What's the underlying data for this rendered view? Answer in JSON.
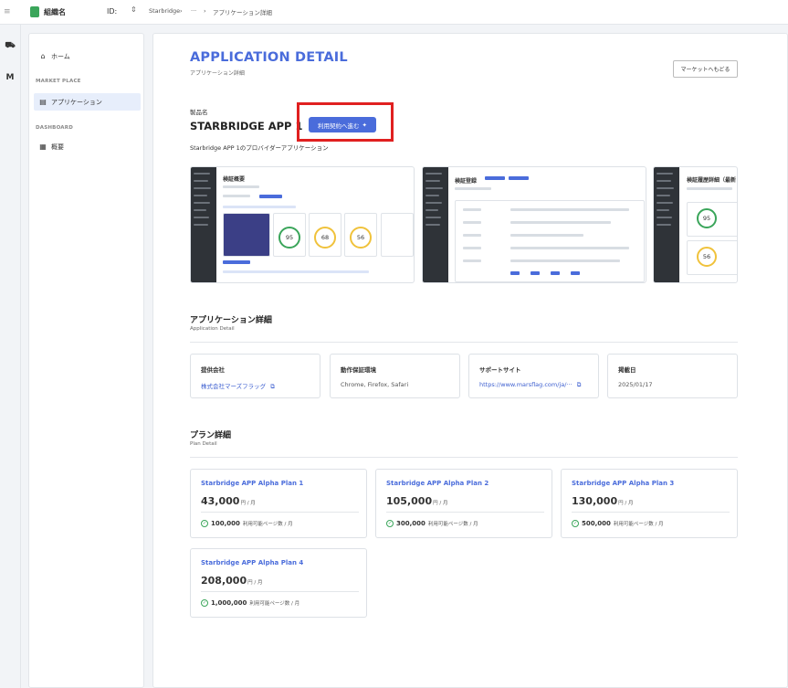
{
  "topbar": {
    "org_name": "組織名",
    "id_label": "ID:",
    "breadcrumb": [
      "Starbridge",
      "···",
      "アプリケーション詳細"
    ],
    "separator": "›"
  },
  "sidebar": {
    "items": [
      {
        "label": "ホーム",
        "icon": "home-icon"
      },
      {
        "label": "アプリケーション",
        "icon": "store-icon"
      },
      {
        "label": "概要",
        "icon": "dashboard-icon"
      }
    ],
    "sections": [
      "MARKET PLACE",
      "DASHBOARD"
    ]
  },
  "header": {
    "title": "APPLICATION DETAIL",
    "subtitle": "アプリケーション詳細",
    "back_label": "マーケットへもどる"
  },
  "product": {
    "label": "製品名",
    "name": "STARBRIDGE APP 1",
    "cta_label": "利用契約へ進む",
    "description": "Starbridge APP 1のプロバイダーアプリケーション"
  },
  "screenshots": [
    {
      "title": "検証概要",
      "gauges": [
        "95",
        "68",
        "56"
      ]
    },
    {
      "title": "検証登録"
    },
    {
      "title": "検証履歴詳細（最新",
      "gauges": [
        "95",
        "56"
      ]
    }
  ],
  "detail_section": {
    "title": "アプリケーション詳細",
    "subtitle": "Application Detail",
    "cards": [
      {
        "label": "提供会社",
        "value": "株式会社マーズフラッグ",
        "link": true
      },
      {
        "label": "動作保証環境",
        "value": "Chrome, Firefox, Safari",
        "link": false
      },
      {
        "label": "サポートサイト",
        "value": "https://www.marsflag.com/ja/···",
        "link": true
      },
      {
        "label": "掲載日",
        "value": "2025/01/17",
        "link": false
      }
    ]
  },
  "plan_section": {
    "title": "プラン詳細",
    "subtitle": "Plan Detail",
    "plans": [
      {
        "name": "Starbridge APP Alpha Plan 1",
        "price": "43,000",
        "price_unit": "円 / 月",
        "pages": "100,000",
        "pages_unit": "利用可能ページ数 / 月"
      },
      {
        "name": "Starbridge APP Alpha Plan 2",
        "price": "105,000",
        "price_unit": "円 / 月",
        "pages": "300,000",
        "pages_unit": "利用可能ページ数 / 月"
      },
      {
        "name": "Starbridge APP Alpha Plan 3",
        "price": "130,000",
        "price_unit": "円 / 月",
        "pages": "500,000",
        "pages_unit": "利用可能ページ数 / 月"
      },
      {
        "name": "Starbridge APP Alpha Plan 4",
        "price": "208,000",
        "price_unit": "円 / 月",
        "pages": "1,000,000",
        "pages_unit": "利用可能ページ数 / 月"
      }
    ]
  },
  "colors": {
    "accent": "#4a6cdb",
    "highlight": "#e02020",
    "success": "#3aa55a",
    "warning": "#f0c23b"
  }
}
